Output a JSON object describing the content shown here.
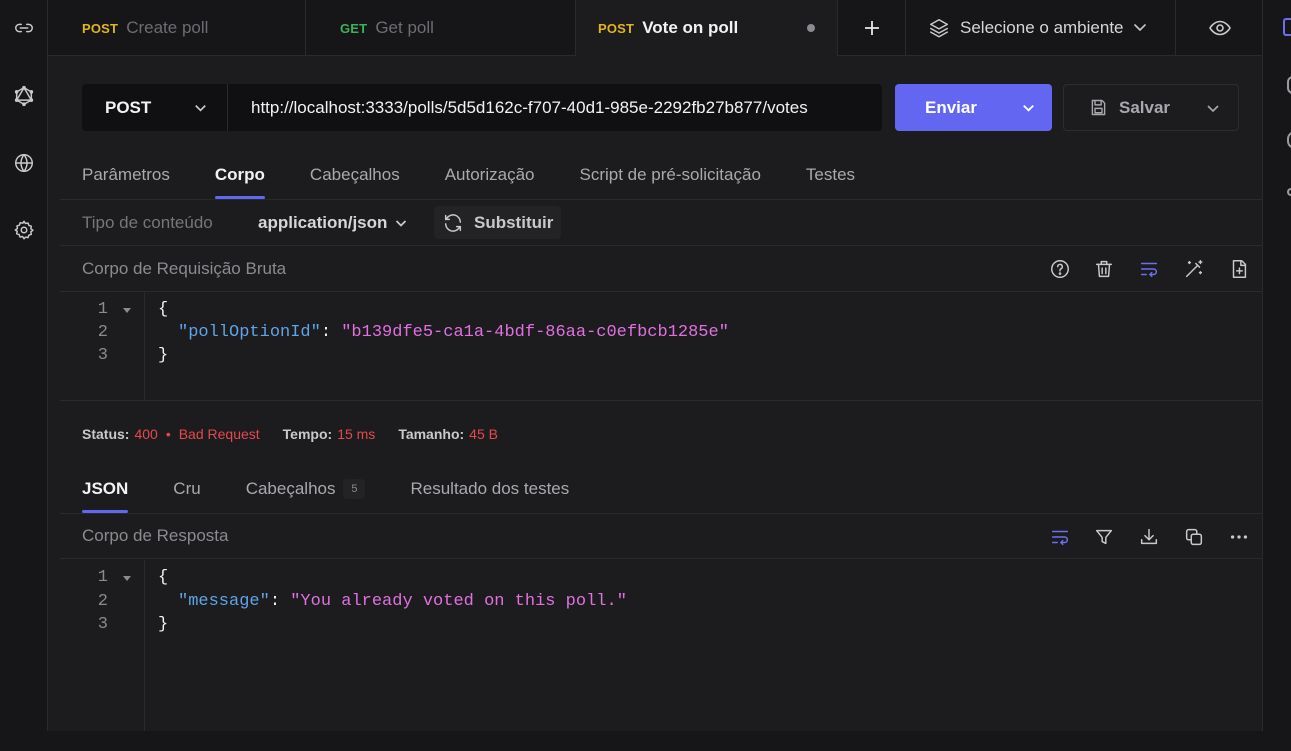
{
  "tabs": [
    {
      "method": "POST",
      "name": "Create poll"
    },
    {
      "method": "GET",
      "name": "Get poll"
    },
    {
      "method": "POST",
      "name": "Vote on poll"
    }
  ],
  "environment": {
    "label": "Selecione o ambiente"
  },
  "request": {
    "method": "POST",
    "url": "http://localhost:3333/polls/5d5d162c-f707-40d1-985e-2292fb27b877/votes",
    "send_label": "Enviar",
    "save_label": "Salvar"
  },
  "request_tabs": [
    "Parâmetros",
    "Corpo",
    "Cabeçalhos",
    "Autorização",
    "Script de pré-solicitação",
    "Testes"
  ],
  "content_type": {
    "label": "Tipo de conteúdo",
    "value": "application/json",
    "replace_label": "Substituir"
  },
  "request_body": {
    "title": "Corpo de Requisição Bruta",
    "lines": [
      "1",
      "2",
      "3"
    ],
    "open": "{",
    "key": "\"pollOptionId\"",
    "colon": ": ",
    "value": "\"b139dfe5-ca1a-4bdf-86aa-c0efbcb1285e\"",
    "close": "}"
  },
  "response_status": {
    "status_label": "Status:",
    "status_code": "400",
    "bullet": "•",
    "status_text": "Bad Request",
    "time_label": "Tempo:",
    "time_value": "15 ms",
    "size_label": "Tamanho:",
    "size_value": "45 B"
  },
  "response_tabs": {
    "json": "JSON",
    "raw": "Cru",
    "headers": "Cabeçalhos",
    "headers_count": "5",
    "tests": "Resultado dos testes"
  },
  "response_body": {
    "title": "Corpo de Resposta",
    "lines": [
      "1",
      "2",
      "3"
    ],
    "open": "{",
    "key": "\"message\"",
    "colon": ": ",
    "value": "\"You already voted on this poll.\"",
    "close": "}"
  },
  "colors": {
    "accent": "#6366f1",
    "post": "#e4b41c",
    "get": "#3bb25a",
    "error": "#e5484d"
  }
}
